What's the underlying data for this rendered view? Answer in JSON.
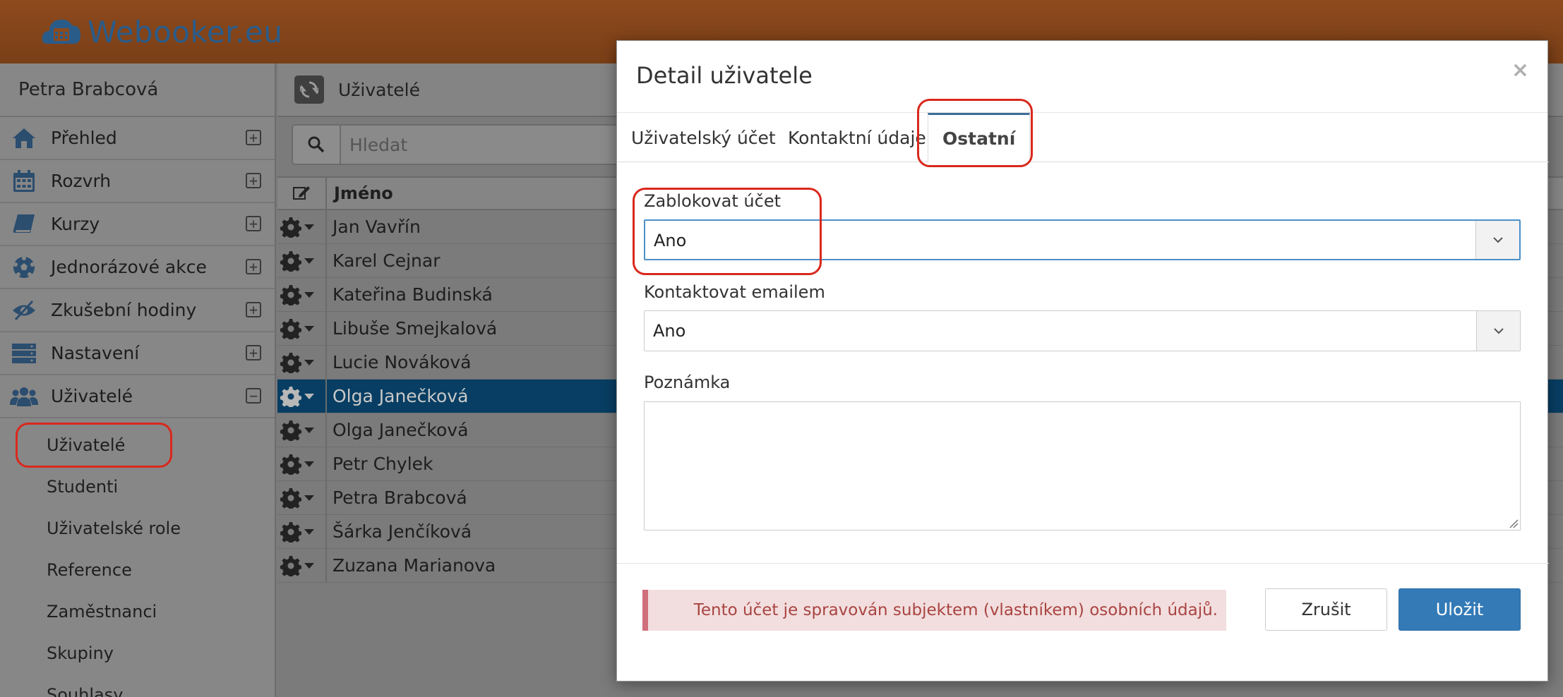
{
  "app": {
    "title": "Webooker.eu"
  },
  "sidebar": {
    "user_name": "Petra Brabcová",
    "items": [
      {
        "label": "Přehled",
        "icon": "home-icon",
        "expander": "+"
      },
      {
        "label": "Rozvrh",
        "icon": "calendar-icon",
        "expander": "+"
      },
      {
        "label": "Kurzy",
        "icon": "book-icon",
        "expander": "+"
      },
      {
        "label": "Jednorázové akce",
        "icon": "soccer-ball-icon",
        "expander": "+"
      },
      {
        "label": "Zkušební hodiny",
        "icon": "eye-slash-icon",
        "expander": "+"
      },
      {
        "label": "Nastavení",
        "icon": "server-icon",
        "expander": "+"
      },
      {
        "label": "Uživatelé",
        "icon": "users-icon",
        "expander": "−"
      }
    ],
    "subitems": [
      "Uživatelé",
      "Studenti",
      "Uživatelské role",
      "Reference",
      "Zaměstnanci",
      "Skupiny",
      "Souhlasy"
    ]
  },
  "main": {
    "title": "Uživatelé",
    "search_placeholder": "Hledat",
    "table": {
      "column_name": "Jméno",
      "rows": [
        "Jan Vavřín",
        "Karel Cejnar",
        "Kateřina Budinská",
        "Libuše Smejkalová",
        "Lucie Nováková",
        "Olga Janečková",
        "Olga Janečková",
        "Petr Chylek",
        "Petra Brabcová",
        "Šárka Jenčíková",
        "Zuzana Marianova"
      ],
      "selected_index": 5
    }
  },
  "modal": {
    "title": "Detail uživatele",
    "close": "×",
    "tabs": [
      "Uživatelský účet",
      "Kontaktní údaje",
      "Ostatní"
    ],
    "active_tab": "Ostatní",
    "fields": {
      "block_label": "Zablokovat účet",
      "block_value": "Ano",
      "email_label": "Kontaktovat emailem",
      "email_value": "Ano",
      "note_label": "Poznámka"
    },
    "alert": "Tento účet je spravován subjektem (vlastníkem) osobních údajů.",
    "cancel": "Zrušit",
    "save": "Uložit"
  },
  "colors": {
    "header": "#8d4a1d",
    "primary": "#337ab7",
    "highlight": "#d9281c",
    "selected_row": "#083e63"
  }
}
